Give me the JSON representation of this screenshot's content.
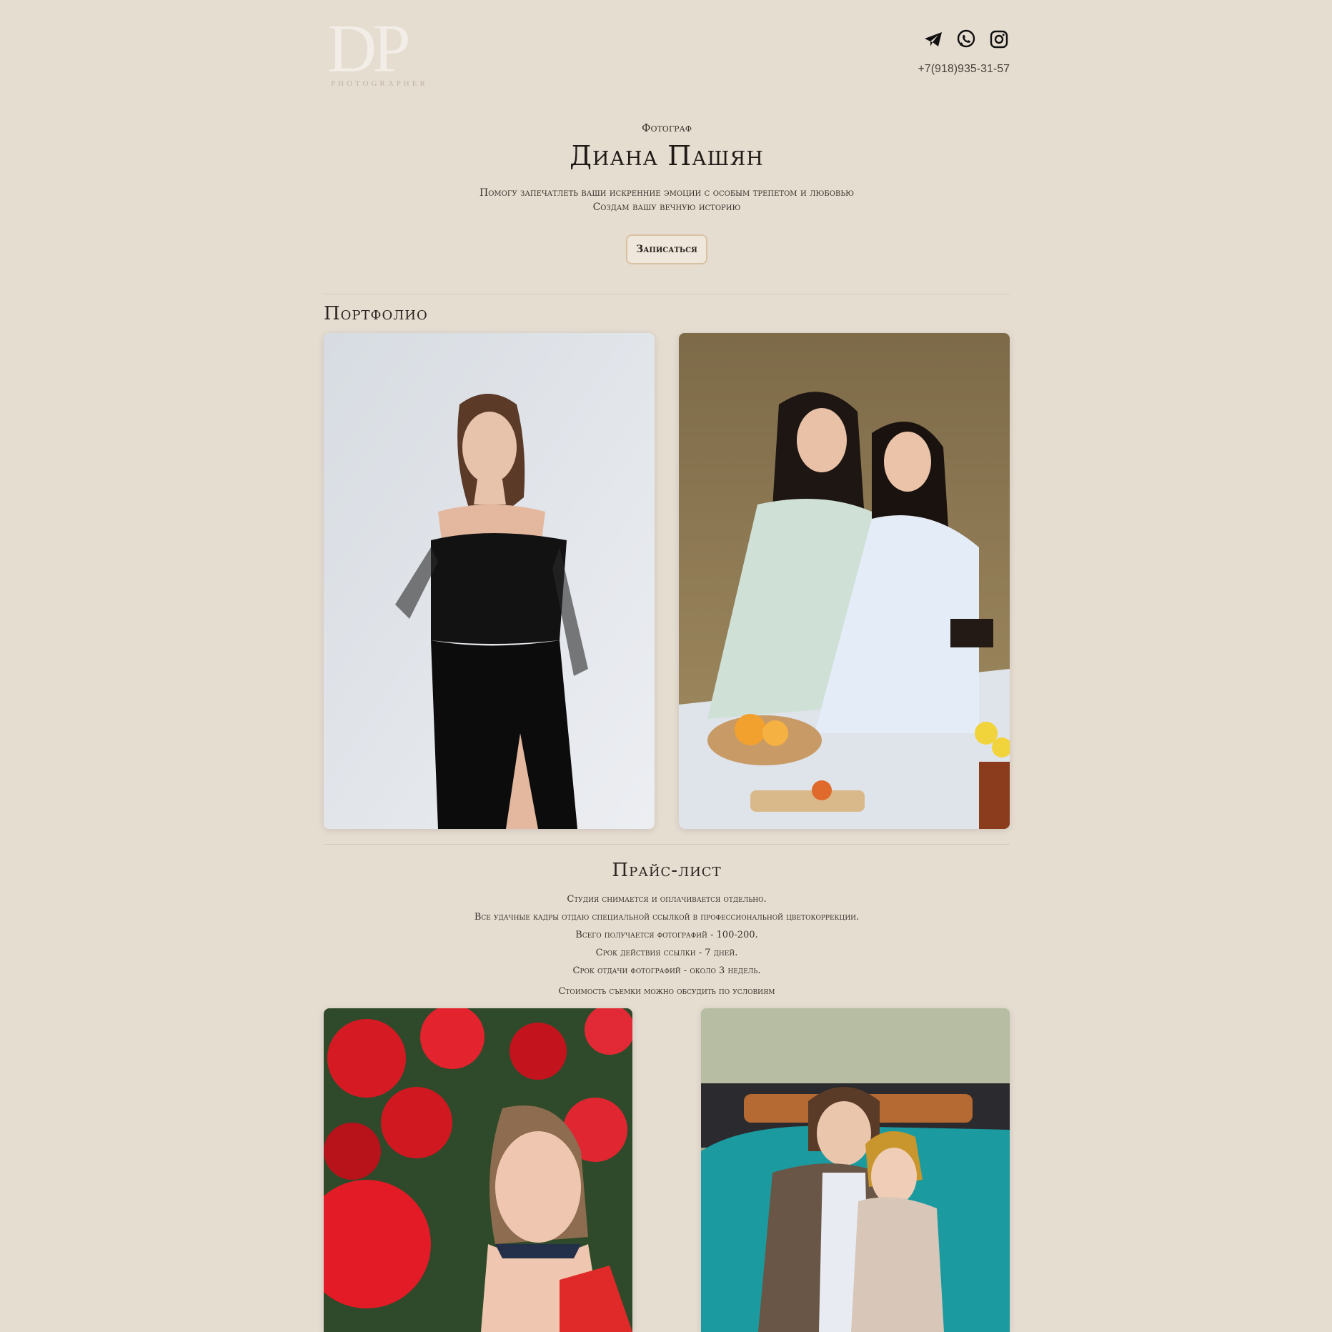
{
  "brand": {
    "logo_letters": "DP",
    "logo_subtitle": "PHOTOGRAPHER"
  },
  "header": {
    "phone": "+7(918)935-31-57",
    "social": [
      {
        "name": "telegram-icon"
      },
      {
        "name": "whatsapp-icon"
      },
      {
        "name": "instagram-icon"
      }
    ]
  },
  "hero": {
    "kicker": "Фотограф",
    "name": "Диана Пашян",
    "line1": "Помогу запечатлеть ваши искренние эмоции с особым трепетом и любовью",
    "line2": "Создам вашу вечную историю",
    "cta_label": "Записаться"
  },
  "portfolio": {
    "title": "Портфолио"
  },
  "price": {
    "title": "Прайс-лист",
    "lines": [
      "Студия снимается и оплачивается отдельно.",
      "Все удачные кадры отдаю специальной ссылкой в профессиональной цветокоррекции.",
      "Всего получается фотографий - 100-200.",
      "Срок действия ссылки - 7 дней.",
      "Срок отдачи фотографий - около 3 недель."
    ],
    "note": "Стоимость съемки можно обсудить по условиям"
  },
  "colors": {
    "background": "#e6ddd1",
    "accent_border": "#d8c1a1",
    "text": "#2b2520"
  }
}
